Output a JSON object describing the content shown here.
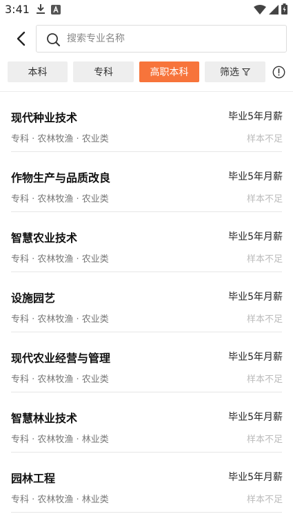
{
  "status_bar": {
    "time": "3:41",
    "left_icons": [
      "download-icon",
      "a-icon"
    ],
    "right_icons": [
      "wifi-icon",
      "signal-icon",
      "battery-icon"
    ]
  },
  "search": {
    "placeholder": "搜索专业名称",
    "value": ""
  },
  "tabs": [
    {
      "label": "本科",
      "active": false
    },
    {
      "label": "专科",
      "active": false
    },
    {
      "label": "高职本科",
      "active": true
    },
    {
      "label": "筛选",
      "active": false,
      "icon": "filter-icon"
    }
  ],
  "accent_color": "#f7743b",
  "majors": [
    {
      "name": "现代种业技术",
      "meta": "专科 · 农林牧渔 · 农业类",
      "salary_label": "毕业5年月薪",
      "salary_value": "样本不足"
    },
    {
      "name": "作物生产与品质改良",
      "meta": "专科 · 农林牧渔 · 农业类",
      "salary_label": "毕业5年月薪",
      "salary_value": "样本不足"
    },
    {
      "name": "智慧农业技术",
      "meta": "专科 · 农林牧渔 · 农业类",
      "salary_label": "毕业5年月薪",
      "salary_value": "样本不足"
    },
    {
      "name": "设施园艺",
      "meta": "专科 · 农林牧渔 · 农业类",
      "salary_label": "毕业5年月薪",
      "salary_value": "样本不足"
    },
    {
      "name": "现代农业经营与管理",
      "meta": "专科 · 农林牧渔 · 农业类",
      "salary_label": "毕业5年月薪",
      "salary_value": "样本不足"
    },
    {
      "name": "智慧林业技术",
      "meta": "专科 · 农林牧渔 · 林业类",
      "salary_label": "毕业5年月薪",
      "salary_value": "样本不足"
    },
    {
      "name": "园林工程",
      "meta": "专科 · 农林牧渔 · 林业类",
      "salary_label": "毕业5年月薪",
      "salary_value": "样本不足"
    }
  ]
}
